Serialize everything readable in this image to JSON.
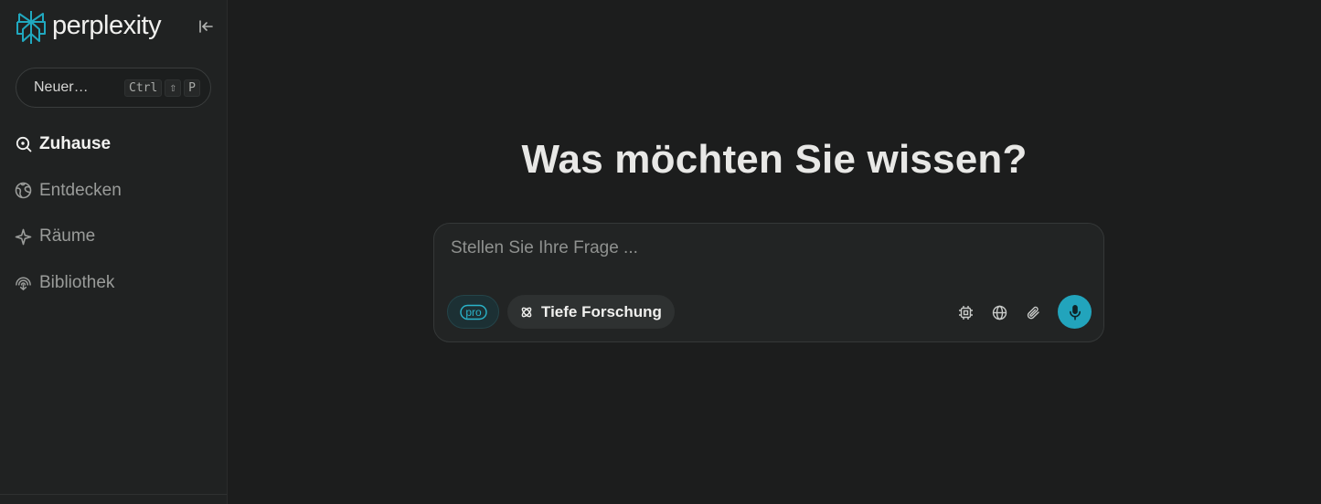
{
  "brand": {
    "name": "perplexity",
    "logo_icon": "perplexity-logo-icon",
    "accent": "#20a8bf"
  },
  "sidebar": {
    "collapse_icon": "collapse-sidebar-icon",
    "new_thread": {
      "label": "Neuer…",
      "shortcut": [
        "Ctrl",
        "⇧",
        "P"
      ]
    },
    "items": [
      {
        "label": "Zuhause",
        "icon": "search-home-icon",
        "active": true
      },
      {
        "label": "Entdecken",
        "icon": "globe-discover-icon",
        "active": false
      },
      {
        "label": "Räume",
        "icon": "spaces-sparkle-icon",
        "active": false
      },
      {
        "label": "Bibliothek",
        "icon": "library-icon",
        "active": false
      }
    ]
  },
  "main": {
    "headline": "Was möchten Sie wissen?",
    "composer": {
      "placeholder": "Stellen Sie Ihre Frage ...",
      "value": "",
      "pro_label": "pro",
      "deep_research_label": "Tiefe Forschung",
      "tools": [
        "model-chip-icon",
        "globe-icon",
        "paperclip-icon"
      ],
      "mic_icon": "microphone-icon",
      "mic_color": "#22a4bc"
    }
  }
}
